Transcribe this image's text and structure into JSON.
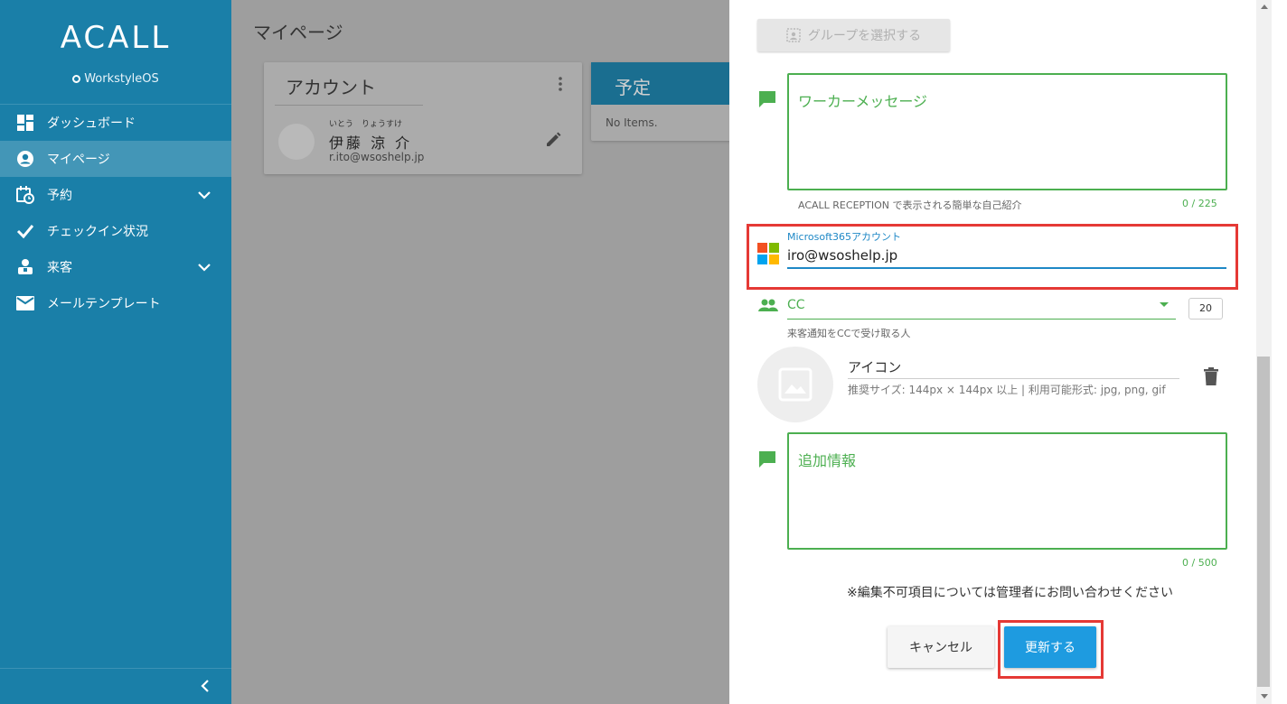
{
  "sidebar": {
    "logo": "ACALL",
    "sub_logo": "WorkstyleOS",
    "items": [
      {
        "label": "ダッシュボード",
        "icon": "dashboard-icon"
      },
      {
        "label": "マイページ",
        "icon": "account-circle-icon",
        "active": true
      },
      {
        "label": "予約",
        "icon": "calendar-clock-icon",
        "expandable": true
      },
      {
        "label": "チェックイン状況",
        "icon": "check-icon"
      },
      {
        "label": "来客",
        "icon": "visitor-icon",
        "expandable": true
      },
      {
        "label": "メールテンプレート",
        "icon": "mail-icon"
      }
    ]
  },
  "main": {
    "title": "マイページ",
    "account": {
      "heading": "アカウント",
      "ruby": "いとう　りょうすけ",
      "name": "伊藤 涼 介",
      "email": "r.ito@wsoshelp.jp"
    },
    "schedule": {
      "heading": "予定",
      "empty": "No Items."
    }
  },
  "panel": {
    "group_button": "グループを選択する",
    "worker_message": {
      "label": "ワーカーメッセージ",
      "hint": "ACALL RECEPTION で表示される簡単な自己紹介",
      "counter": "0 / 225"
    },
    "microsoft": {
      "label": "Microsoft365アカウント",
      "value": "iro@wsoshelp.jp"
    },
    "cc": {
      "label": "CC",
      "hint": "来客通知をCCで受け取る人",
      "count": "20"
    },
    "icon_field": {
      "title": "アイコン",
      "hint": "推奨サイズ: 144px × 144px 以上 | 利用可能形式: jpg, png, gif"
    },
    "additional": {
      "label": "追加情報",
      "counter": "0 / 500"
    },
    "notice": "※編集不可項目については管理者にお問い合わせください",
    "cancel_label": "キャンセル",
    "update_label": "更新する"
  },
  "colors": {
    "sidebar": "#1a7fa8",
    "green": "#4caf50",
    "primary": "#1e9be0",
    "highlight": "#e53935"
  }
}
